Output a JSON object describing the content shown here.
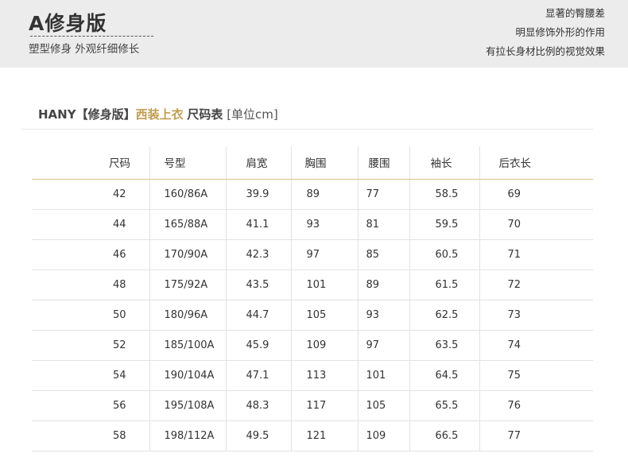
{
  "banner": {
    "title": "A修身版",
    "subtitle": "塑型修身 外观纤细修长",
    "features": [
      "显著的臀腰差",
      "明显修饰外形的作用",
      "有拉长身材比例的视觉效果"
    ]
  },
  "heading": {
    "brand": "HANY【修身版】",
    "product": "西装上衣",
    "table_name": "尺码表",
    "unit": "[单位cm]"
  },
  "table": {
    "columns": [
      "尺码",
      "号型",
      "肩宽",
      "胸围",
      "腰围",
      "袖长",
      "后衣长"
    ],
    "rows": [
      [
        "42",
        "160/86A",
        "39.9",
        "89",
        "77",
        "58.5",
        "69"
      ],
      [
        "44",
        "165/88A",
        "41.1",
        "93",
        "81",
        "59.5",
        "70"
      ],
      [
        "46",
        "170/90A",
        "42.3",
        "97",
        "85",
        "60.5",
        "71"
      ],
      [
        "48",
        "175/92A",
        "43.5",
        "101",
        "89",
        "61.5",
        "72"
      ],
      [
        "50",
        "180/96A",
        "44.7",
        "105",
        "93",
        "62.5",
        "73"
      ],
      [
        "52",
        "185/100A",
        "45.9",
        "109",
        "97",
        "63.5",
        "74"
      ],
      [
        "54",
        "190/104A",
        "47.1",
        "113",
        "101",
        "64.5",
        "75"
      ],
      [
        "56",
        "195/108A",
        "48.3",
        "117",
        "105",
        "65.5",
        "76"
      ],
      [
        "58",
        "198/112A",
        "49.5",
        "121",
        "109",
        "66.5",
        "77"
      ]
    ]
  },
  "colors": {
    "banner_bg": "#ececec",
    "accent_gold": "#c19d4f",
    "header_rule": "#d8c48a",
    "grid_line": "#e3e3e3"
  }
}
